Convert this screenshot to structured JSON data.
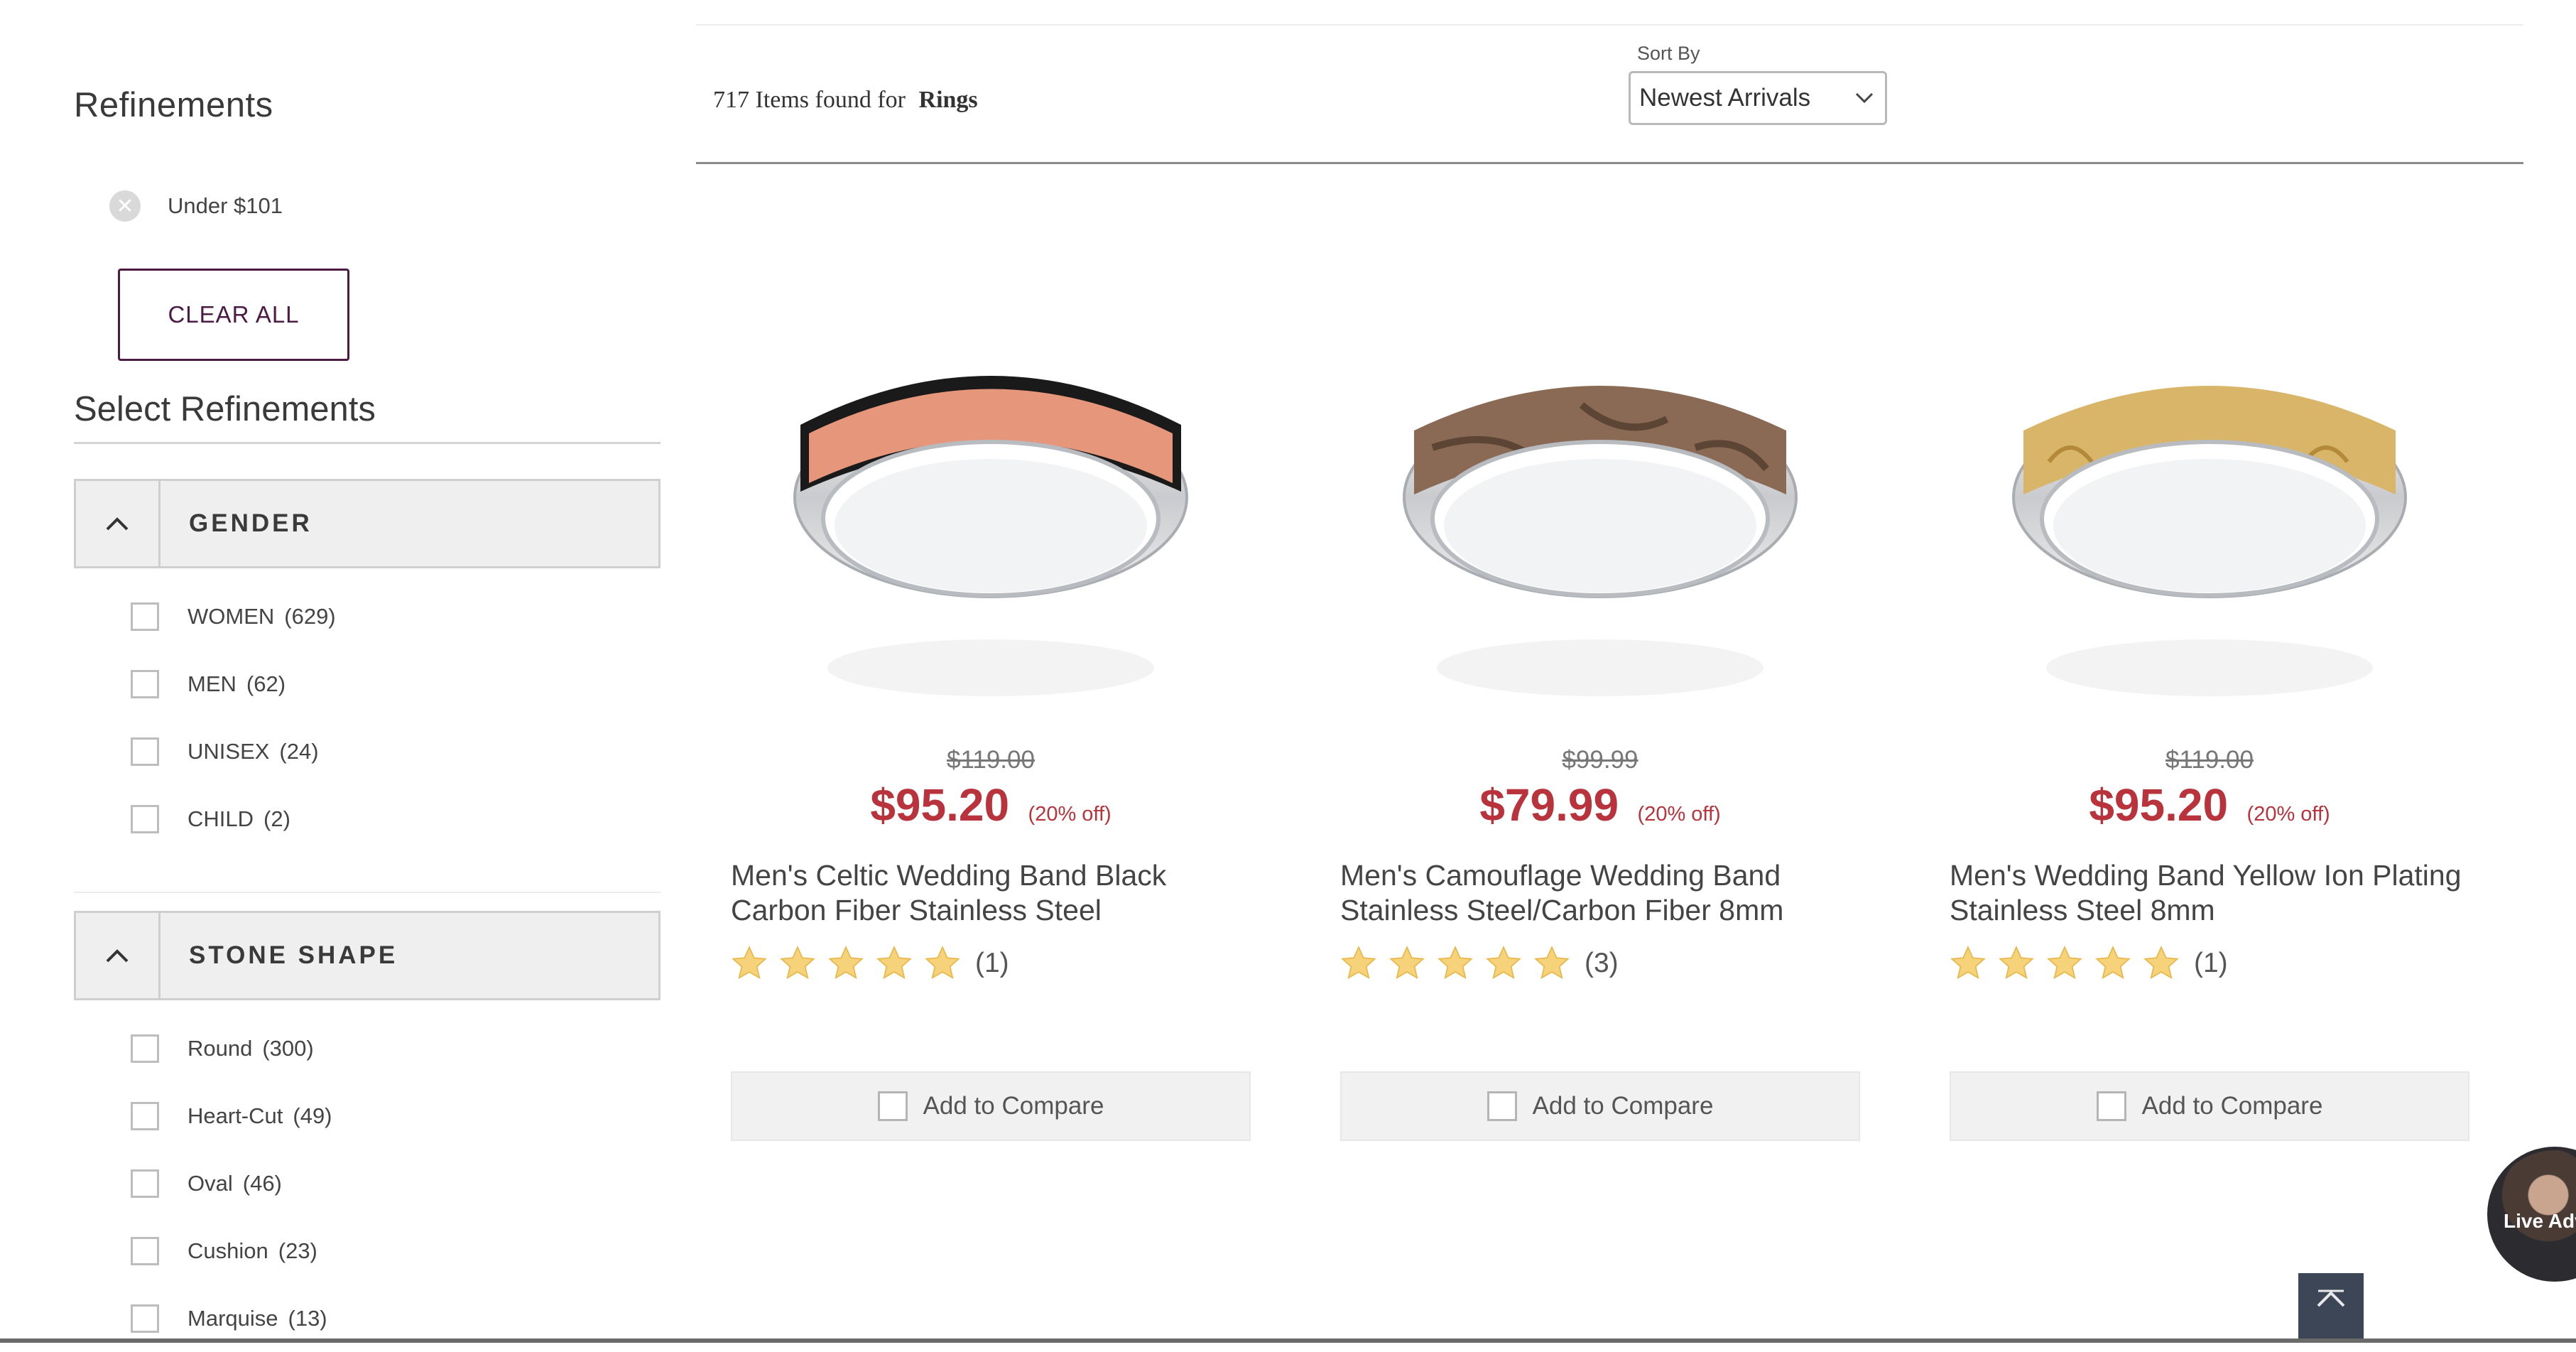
{
  "sidebar": {
    "refinements_title": "Refinements",
    "active_filters": [
      {
        "label": "Under $101"
      }
    ],
    "clear_all_label": "CLEAR ALL",
    "select_refinements_title": "Select Refinements",
    "facets": [
      {
        "title": "GENDER",
        "items": [
          {
            "label": "WOMEN",
            "count": "(629)"
          },
          {
            "label": "MEN",
            "count": "(62)"
          },
          {
            "label": "UNISEX",
            "count": "(24)"
          },
          {
            "label": "CHILD",
            "count": "(2)"
          }
        ]
      },
      {
        "title": "STONE SHAPE",
        "items": [
          {
            "label": "Round",
            "count": "(300)"
          },
          {
            "label": "Heart-Cut",
            "count": "(49)"
          },
          {
            "label": "Oval",
            "count": "(46)"
          },
          {
            "label": "Cushion",
            "count": "(23)"
          },
          {
            "label": "Marquise",
            "count": "(13)"
          }
        ]
      }
    ]
  },
  "results": {
    "count": "717",
    "found_text": "Items found for",
    "query": "Rings"
  },
  "sort": {
    "label": "Sort By",
    "selected": "Newest Arrivals"
  },
  "products": [
    {
      "was_price": "$119.00",
      "price": "$95.20",
      "discount": "(20% off)",
      "name": "Men's Celtic Wedding Band Black Carbon Fiber Stainless Steel",
      "rating": 5,
      "review_count": "(1)",
      "compare_label": "Add to Compare",
      "inlay_color": "#e6967a"
    },
    {
      "was_price": "$99.99",
      "price": "$79.99",
      "discount": "(20% off)",
      "name": "Men's Camouflage Wedding Band Stainless Steel/Carbon Fiber 8mm",
      "rating": 5,
      "review_count": "(3)",
      "compare_label": "Add to Compare",
      "inlay_color": "#8a6a55"
    },
    {
      "was_price": "$119.00",
      "price": "$95.20",
      "discount": "(20% off)",
      "name": "Men's Wedding Band Yellow Ion Plating Stainless Steel 8mm",
      "rating": 5,
      "review_count": "(1)",
      "compare_label": "Add to Compare",
      "inlay_color": "#d9b56a"
    }
  ],
  "widgets": {
    "live_advisor_label": "Live Adv",
    "scroll_top_icon": "chevron-up-icon"
  },
  "colors": {
    "accent": "#4b1b45",
    "price_red": "#b8333c",
    "star_gold": "#f4c84a"
  }
}
